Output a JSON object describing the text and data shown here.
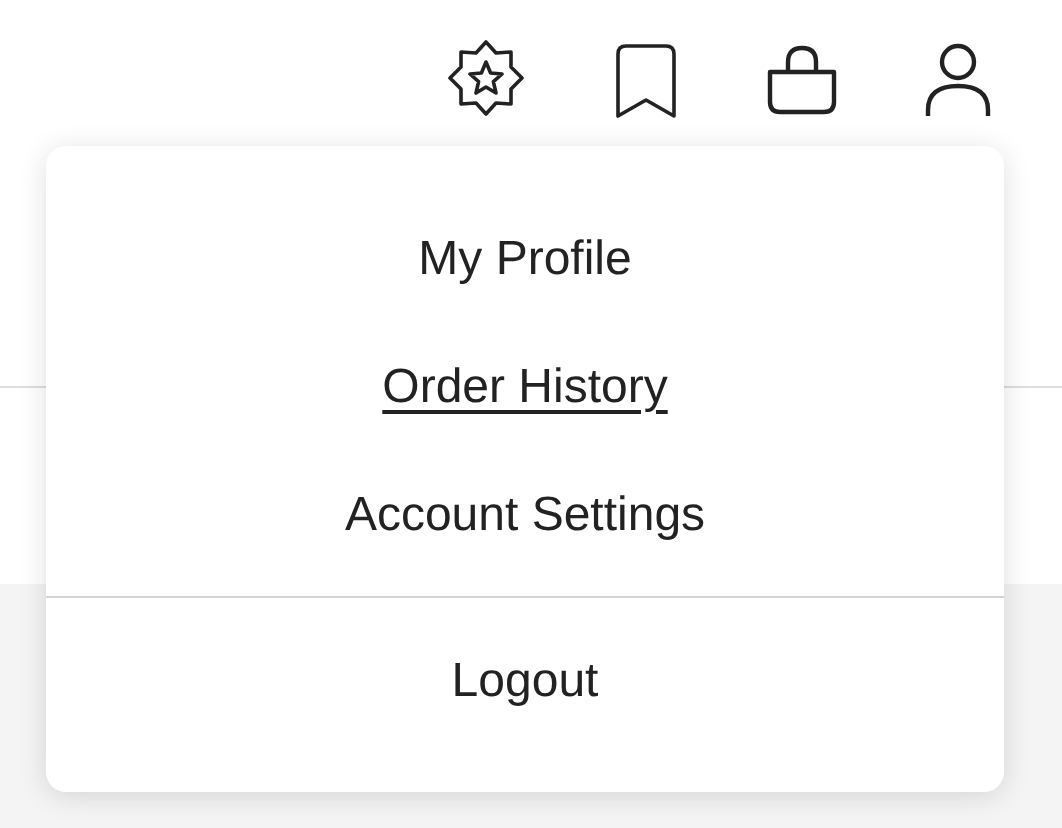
{
  "account_menu": {
    "sections": [
      {
        "items": [
          {
            "label": "My Profile",
            "hovered": false
          },
          {
            "label": "Order History",
            "hovered": true
          },
          {
            "label": "Account Settings",
            "hovered": false
          }
        ]
      },
      {
        "items": [
          {
            "label": "Logout",
            "hovered": false
          }
        ]
      }
    ]
  }
}
